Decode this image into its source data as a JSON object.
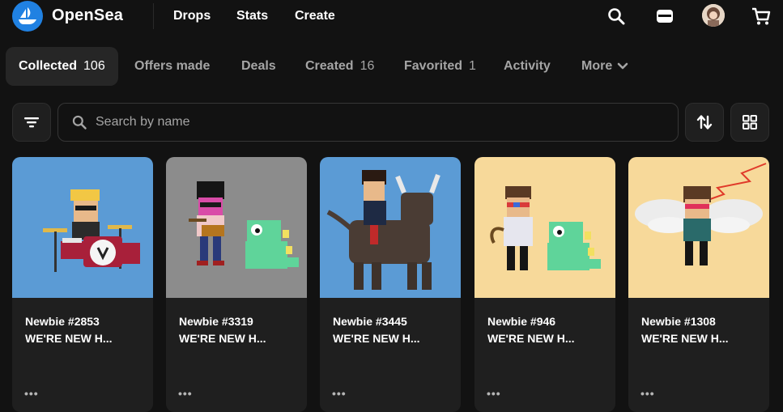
{
  "brand": {
    "name": "OpenSea"
  },
  "nav": {
    "links": [
      "Drops",
      "Stats",
      "Create"
    ]
  },
  "icons": {
    "search": "search-icon",
    "wallet": "wallet-icon",
    "cart": "cart-icon",
    "filter": "filter-icon",
    "sort": "sort-icon",
    "grid": "grid-icon"
  },
  "tabs": [
    {
      "label": "Collected",
      "count": "106",
      "active": true
    },
    {
      "label": "Offers made",
      "count": ""
    },
    {
      "label": "Deals",
      "count": ""
    },
    {
      "label": "Created",
      "count": "16"
    },
    {
      "label": "Favorited",
      "count": "1"
    },
    {
      "label": "Activity",
      "count": ""
    },
    {
      "label": "More",
      "count": ""
    }
  ],
  "search": {
    "placeholder": "Search by name",
    "value": ""
  },
  "colors": {
    "accent": "#2081e2",
    "bg": "#121212",
    "card": "#1f1f1f"
  },
  "cards": [
    {
      "title": "Newbie #2853",
      "subtitle": "WE'RE NEW H...",
      "more": "•••",
      "bg": "#5b9bd5"
    },
    {
      "title": "Newbie #3319",
      "subtitle": "WE'RE NEW H...",
      "more": "•••",
      "bg": "#8c8c8c"
    },
    {
      "title": "Newbie #3445",
      "subtitle": "WE'RE NEW H...",
      "more": "•••",
      "bg": "#5b9bd5"
    },
    {
      "title": "Newbie #946",
      "subtitle": "WE'RE NEW H...",
      "more": "•••",
      "bg": "#f7d99a"
    },
    {
      "title": "Newbie #1308",
      "subtitle": "WE'RE NEW H...",
      "more": "•••",
      "bg": "#f7d99a"
    }
  ]
}
